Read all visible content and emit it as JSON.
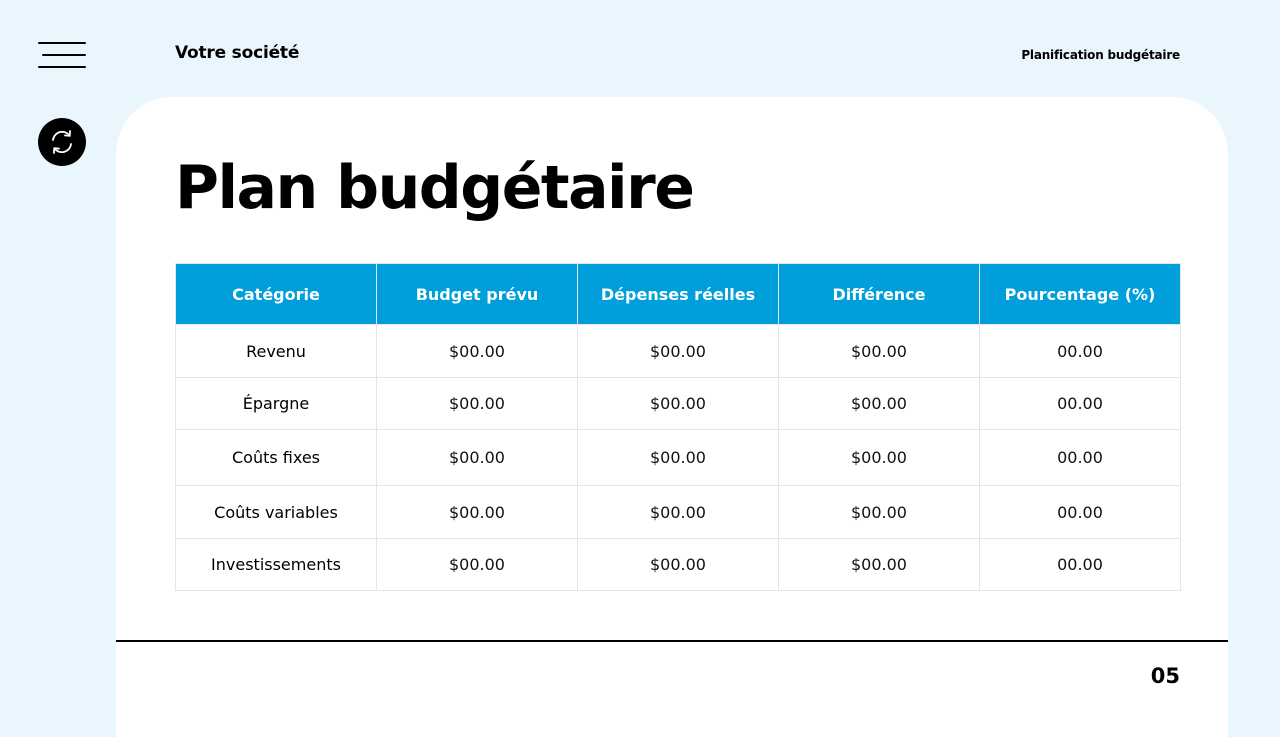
{
  "header": {
    "company": "Votre société",
    "subtitle": "Planification budgétaire"
  },
  "sidebar": {
    "menu_icon": "hamburger-menu-icon",
    "refresh_icon": "refresh-icon"
  },
  "title": "Plan budgétaire",
  "table": {
    "columns": [
      "Catégorie",
      "Budget prévu",
      "Dépenses réelles",
      "Différence",
      "Pourcentage (%)"
    ],
    "rows": [
      [
        "Revenu",
        "$00.00",
        "$00.00",
        "$00.00",
        "00.00"
      ],
      [
        "Épargne",
        "$00.00",
        "$00.00",
        "$00.00",
        "00.00"
      ],
      [
        "Coûts fixes",
        "$00.00",
        "$00.00",
        "$00.00",
        "00.00"
      ],
      [
        "Coûts variables",
        "$00.00",
        "$00.00",
        "$00.00",
        "00.00"
      ],
      [
        "Investissements",
        "$00.00",
        "$00.00",
        "$00.00",
        "00.00"
      ]
    ]
  },
  "footer": {
    "page_number": "05"
  },
  "colors": {
    "background": "#eaf6fd",
    "header_accent": "#009fdb",
    "card": "#ffffff",
    "text": "#000000"
  }
}
